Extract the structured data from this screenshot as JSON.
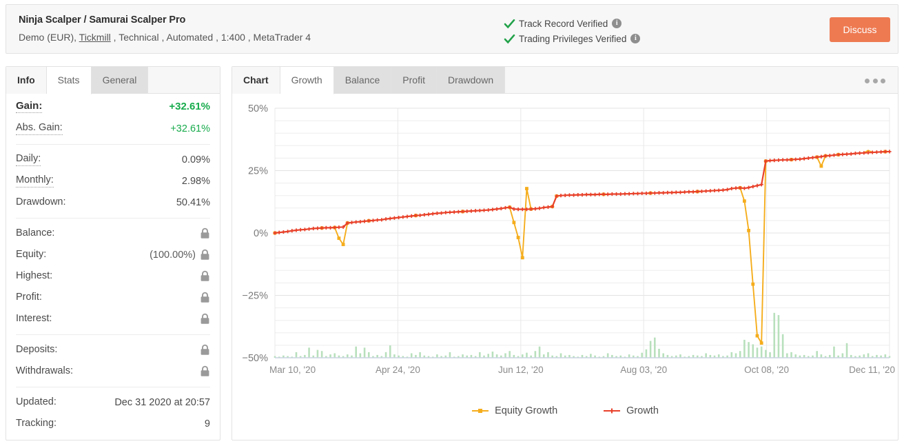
{
  "header": {
    "title": "Ninja Scalper / Samurai Scalper Pro",
    "subtitle_pre": "Demo (EUR), ",
    "broker_link": "Tickmill",
    "subtitle_post": " , Technical , Automated , 1:400 , MetaTrader 4",
    "verified": [
      {
        "label": "Track Record Verified",
        "icon": "check-icon",
        "info": "i"
      },
      {
        "label": "Trading Privileges Verified",
        "icon": "check-icon",
        "info": "i"
      }
    ],
    "discuss_label": "Discuss",
    "discuss_color": "#ee7a52",
    "check_color": "#22a24a"
  },
  "left_panel": {
    "tabs": [
      {
        "label": "Info",
        "state": "first"
      },
      {
        "label": "Stats",
        "state": "active"
      },
      {
        "label": "General",
        "state": "grey"
      }
    ],
    "groups": [
      {
        "rows": [
          {
            "label": "Gain:",
            "value": "+32.61%",
            "style": "big-green",
            "dotted": true
          },
          {
            "label": "Abs. Gain:",
            "value": "+32.61%",
            "style": "green",
            "dotted": true
          }
        ]
      },
      {
        "rows": [
          {
            "label": "Daily:",
            "value": "0.09%",
            "style": "plain",
            "dotted": true
          },
          {
            "label": "Monthly:",
            "value": "2.98%",
            "style": "plain",
            "dotted": true
          },
          {
            "label": "Drawdown:",
            "value": "50.41%",
            "style": "plain",
            "dotted": false
          }
        ]
      },
      {
        "rows": [
          {
            "label": "Balance:",
            "value": "",
            "style": "locked",
            "dotted": false,
            "lock": true
          },
          {
            "label": "Equity:",
            "value": "(100.00%)",
            "style": "locked",
            "dotted": false,
            "lock": true
          },
          {
            "label": "Highest:",
            "value": "",
            "style": "locked",
            "dotted": false,
            "lock": true
          },
          {
            "label": "Profit:",
            "value": "",
            "style": "locked",
            "dotted": false,
            "lock": true
          },
          {
            "label": "Interest:",
            "value": "",
            "style": "locked",
            "dotted": false,
            "lock": true
          }
        ]
      },
      {
        "rows": [
          {
            "label": "Deposits:",
            "value": "",
            "style": "locked",
            "dotted": false,
            "lock": true
          },
          {
            "label": "Withdrawals:",
            "value": "",
            "style": "locked",
            "dotted": false,
            "lock": true
          }
        ]
      },
      {
        "rows": [
          {
            "label": "Updated:",
            "value": "Dec 31 2020 at 20:57",
            "style": "plain",
            "dotted": false
          },
          {
            "label": "Tracking:",
            "value": "9",
            "style": "plain",
            "dotted": false
          }
        ]
      }
    ]
  },
  "right_panel": {
    "tabs": [
      {
        "label": "Chart",
        "state": "first"
      },
      {
        "label": "Growth",
        "state": "active"
      },
      {
        "label": "Balance",
        "state": "grey"
      },
      {
        "label": "Profit",
        "state": "grey"
      },
      {
        "label": "Drawdown",
        "state": "grey"
      }
    ],
    "menu_icon": "more-options-icon"
  },
  "chart_data": {
    "type": "line",
    "title": "",
    "xlabel": "",
    "ylabel": "",
    "ylim": [
      -50,
      50
    ],
    "yticks": [
      50,
      25,
      0,
      -25,
      -50
    ],
    "ytick_labels": [
      "50%",
      "25%",
      "0%",
      "−25%",
      "−50%"
    ],
    "grid": true,
    "minor_grid_step": 5,
    "legend_position": "bottom-center",
    "xtick_labels": [
      "Mar 10, '20",
      "Apr 24, '20",
      "Jun 12, '20",
      "Aug 03, '20",
      "Oct 08, '20",
      "Dec 11, '20"
    ],
    "xtick_positions": [
      0.0,
      0.2,
      0.4,
      0.6,
      0.8,
      1.0
    ],
    "colors": {
      "growth": "#e8402a",
      "equity_growth": "#f5ad1c",
      "volume": "#b8e0bc",
      "grid": "#ededed",
      "axis": "#c9d4e0"
    },
    "series": [
      {
        "name": "Growth",
        "color": "#e8402a",
        "marker": "plus",
        "values": [
          0.0,
          0.2,
          0.4,
          0.6,
          0.9,
          1.1,
          1.3,
          1.4,
          1.6,
          1.8,
          1.9,
          2.0,
          2.1,
          2.1,
          2.2,
          2.3,
          2.4,
          4.0,
          4.2,
          4.4,
          4.5,
          4.7,
          4.9,
          5.0,
          5.2,
          5.3,
          5.6,
          5.8,
          6.0,
          6.2,
          6.4,
          6.6,
          6.8,
          7.0,
          7.1,
          7.3,
          7.5,
          7.7,
          7.9,
          8.0,
          8.2,
          8.3,
          8.4,
          8.5,
          8.6,
          8.7,
          8.8,
          8.9,
          9.0,
          9.1,
          9.2,
          9.4,
          9.6,
          9.8,
          10.1,
          10.3,
          9.6,
          9.5,
          9.5,
          9.5,
          9.6,
          9.7,
          9.9,
          10.2,
          10.4,
          10.6,
          14.8,
          15.0,
          15.1,
          15.2,
          15.2,
          15.3,
          15.3,
          15.4,
          15.4,
          15.4,
          15.5,
          15.5,
          15.5,
          15.6,
          15.6,
          15.6,
          15.7,
          15.7,
          15.8,
          15.8,
          15.9,
          15.9,
          16.0,
          16.0,
          16.1,
          16.1,
          16.2,
          16.2,
          16.3,
          16.3,
          16.4,
          16.5,
          16.5,
          16.6,
          16.7,
          16.8,
          16.9,
          17.0,
          17.1,
          17.2,
          17.4,
          17.8,
          18.0,
          18.1,
          17.9,
          18.2,
          18.6,
          19.0,
          19.4,
          28.8,
          29.0,
          29.1,
          29.2,
          29.3,
          29.3,
          29.4,
          29.5,
          29.6,
          29.8,
          30.0,
          30.2,
          30.4,
          30.6,
          30.9,
          31.0,
          31.2,
          31.4,
          31.5,
          31.6,
          31.7,
          31.9,
          32.0,
          32.1,
          32.2,
          32.3,
          32.4,
          32.5,
          32.6,
          32.61
        ]
      },
      {
        "name": "Equity Growth",
        "color": "#f5ad1c",
        "marker": "square",
        "values": [
          0.0,
          0.2,
          0.4,
          0.6,
          0.9,
          1.1,
          1.3,
          1.4,
          1.6,
          1.8,
          1.9,
          2.0,
          2.1,
          2.1,
          2.2,
          -2.1,
          -4.6,
          4.0,
          4.2,
          4.4,
          4.5,
          4.7,
          4.9,
          5.0,
          5.2,
          5.3,
          5.6,
          5.8,
          6.0,
          6.2,
          6.4,
          6.6,
          6.8,
          7.0,
          7.1,
          7.3,
          7.5,
          7.7,
          7.9,
          8.0,
          8.2,
          8.3,
          8.4,
          8.5,
          8.6,
          8.7,
          8.8,
          8.9,
          9.0,
          9.1,
          9.2,
          9.4,
          9.6,
          9.8,
          10.1,
          10.3,
          4.2,
          -1.8,
          -9.9,
          17.8,
          9.6,
          9.7,
          9.9,
          10.2,
          10.4,
          10.6,
          14.8,
          15.0,
          15.1,
          15.2,
          15.2,
          15.3,
          15.3,
          15.4,
          15.4,
          15.4,
          15.5,
          15.5,
          15.5,
          15.6,
          15.6,
          15.6,
          15.7,
          15.7,
          15.8,
          15.8,
          15.9,
          15.9,
          16.0,
          16.0,
          16.1,
          16.1,
          16.2,
          16.2,
          16.3,
          16.3,
          16.4,
          16.5,
          16.5,
          16.6,
          16.7,
          16.8,
          16.9,
          17.0,
          17.1,
          17.2,
          17.4,
          17.8,
          18.0,
          18.1,
          12.8,
          1.0,
          -20.5,
          -41.2,
          -44.1,
          28.8,
          29.0,
          29.1,
          29.2,
          29.3,
          29.3,
          29.4,
          29.5,
          29.6,
          29.8,
          30.0,
          30.2,
          30.4,
          26.8,
          30.9,
          31.0,
          31.2,
          31.4,
          31.5,
          31.6,
          31.7,
          31.9,
          32.0,
          32.1,
          33.1,
          32.3,
          32.4,
          32.5,
          32.6,
          32.61
        ]
      }
    ],
    "volume_bars": {
      "name": "Volume",
      "color": "#b8e0bc",
      "baseline": -50,
      "max_height_pct": 8,
      "values": [
        0.3,
        0.2,
        0.4,
        0.3,
        0.2,
        1.0,
        0.3,
        0.5,
        1.8,
        0.4,
        1.4,
        1.2,
        0.3,
        0.6,
        0.8,
        0.4,
        0.3,
        0.6,
        0.4,
        2.0,
        0.8,
        1.8,
        1.0,
        0.3,
        0.5,
        0.3,
        1.0,
        2.2,
        0.6,
        0.4,
        0.3,
        0.2,
        0.8,
        0.5,
        1.0,
        0.4,
        0.3,
        0.2,
        0.6,
        0.3,
        0.4,
        1.0,
        0.2,
        0.3,
        0.6,
        0.4,
        0.5,
        0.3,
        1.0,
        0.4,
        0.7,
        1.1,
        0.6,
        0.4,
        0.8,
        1.2,
        0.5,
        0.3,
        0.6,
        0.9,
        0.4,
        1.2,
        2.0,
        0.6,
        1.0,
        0.4,
        0.3,
        0.8,
        0.4,
        0.5,
        0.3,
        0.2,
        0.5,
        0.3,
        0.7,
        0.4,
        0.2,
        0.3,
        0.8,
        0.5,
        0.3,
        0.4,
        0.2,
        0.6,
        0.4,
        0.3,
        0.9,
        1.5,
        3.0,
        3.6,
        1.6,
        0.8,
        0.5,
        0.3,
        0.4,
        0.6,
        0.2,
        0.3,
        0.5,
        0.4,
        0.3,
        0.8,
        0.5,
        0.4,
        0.6,
        0.3,
        0.4,
        1.0,
        0.8,
        1.2,
        3.2,
        2.8,
        2.4,
        1.8,
        2.0,
        1.4,
        1.0,
        8.0,
        7.6,
        4.2,
        0.8,
        1.0,
        0.6,
        0.4,
        0.5,
        0.3,
        0.4,
        1.2,
        0.6,
        0.3,
        0.5,
        2.0,
        0.4,
        0.8,
        2.6,
        0.5,
        0.3,
        0.4,
        0.6,
        0.8,
        0.3,
        0.5,
        0.4,
        0.6,
        0.3
      ]
    }
  }
}
